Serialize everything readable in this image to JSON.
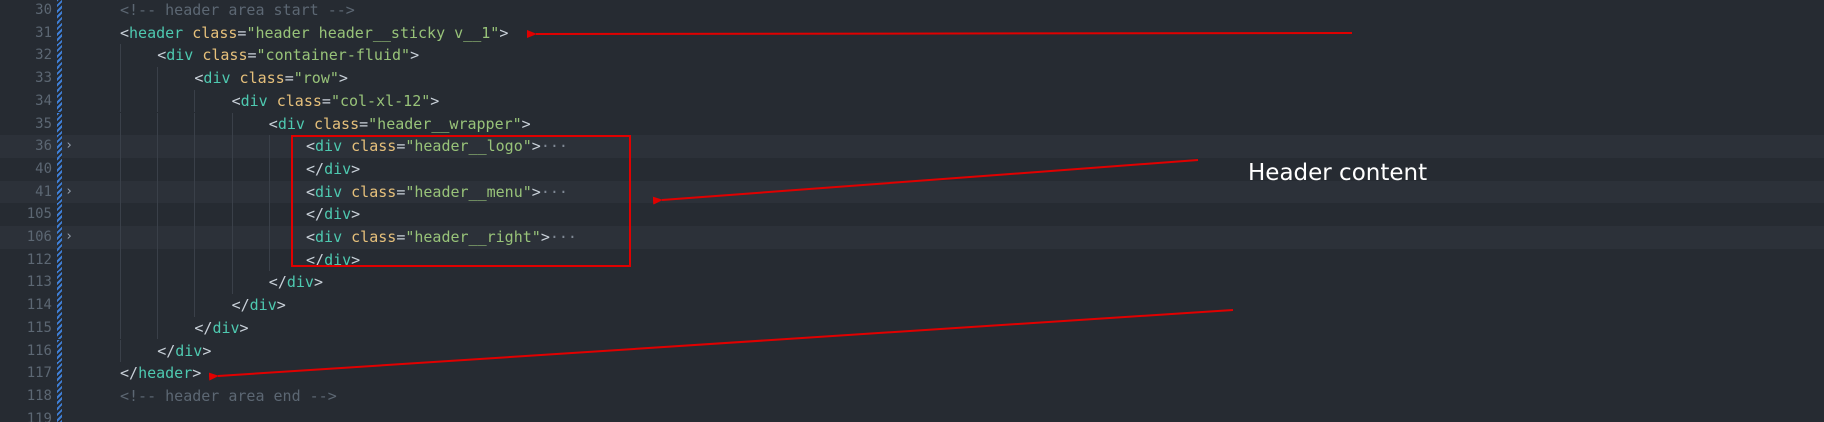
{
  "editor": {
    "lines": [
      {
        "num": "30",
        "indent": 1,
        "tokens": [
          {
            "t": "<!-- header area start -->",
            "c": "comment"
          }
        ]
      },
      {
        "num": "31",
        "indent": 1,
        "tokens": [
          {
            "t": "<",
            "c": "punc"
          },
          {
            "t": "header",
            "c": "tag"
          },
          {
            "t": " ",
            "c": "punc"
          },
          {
            "t": "class",
            "c": "attr"
          },
          {
            "t": "=",
            "c": "eq"
          },
          {
            "t": "\"header header__sticky v__1\"",
            "c": "str"
          },
          {
            "t": ">",
            "c": "punc"
          }
        ]
      },
      {
        "num": "32",
        "indent": 2,
        "tokens": [
          {
            "t": "<",
            "c": "punc"
          },
          {
            "t": "div",
            "c": "tag"
          },
          {
            "t": " ",
            "c": "punc"
          },
          {
            "t": "class",
            "c": "attr"
          },
          {
            "t": "=",
            "c": "eq"
          },
          {
            "t": "\"container-fluid\"",
            "c": "str"
          },
          {
            "t": ">",
            "c": "punc"
          }
        ]
      },
      {
        "num": "33",
        "indent": 3,
        "tokens": [
          {
            "t": "<",
            "c": "punc"
          },
          {
            "t": "div",
            "c": "tag"
          },
          {
            "t": " ",
            "c": "punc"
          },
          {
            "t": "class",
            "c": "attr"
          },
          {
            "t": "=",
            "c": "eq"
          },
          {
            "t": "\"row\"",
            "c": "str"
          },
          {
            "t": ">",
            "c": "punc"
          }
        ]
      },
      {
        "num": "34",
        "indent": 4,
        "tokens": [
          {
            "t": "<",
            "c": "punc"
          },
          {
            "t": "div",
            "c": "tag"
          },
          {
            "t": " ",
            "c": "punc"
          },
          {
            "t": "class",
            "c": "attr"
          },
          {
            "t": "=",
            "c": "eq"
          },
          {
            "t": "\"col-xl-12\"",
            "c": "str"
          },
          {
            "t": ">",
            "c": "punc"
          }
        ]
      },
      {
        "num": "35",
        "indent": 5,
        "tokens": [
          {
            "t": "<",
            "c": "punc"
          },
          {
            "t": "div",
            "c": "tag"
          },
          {
            "t": " ",
            "c": "punc"
          },
          {
            "t": "class",
            "c": "attr"
          },
          {
            "t": "=",
            "c": "eq"
          },
          {
            "t": "\"header__wrapper\"",
            "c": "str"
          },
          {
            "t": ">",
            "c": "punc"
          }
        ]
      },
      {
        "num": "36",
        "indent": 6,
        "folded": true,
        "tokens": [
          {
            "t": "<",
            "c": "punc"
          },
          {
            "t": "div",
            "c": "tag"
          },
          {
            "t": " ",
            "c": "punc"
          },
          {
            "t": "class",
            "c": "attr"
          },
          {
            "t": "=",
            "c": "eq"
          },
          {
            "t": "\"header__logo\"",
            "c": "str"
          },
          {
            "t": ">",
            "c": "punc"
          },
          {
            "t": "···",
            "c": "dots"
          }
        ]
      },
      {
        "num": "40",
        "indent": 6,
        "tokens": [
          {
            "t": "</",
            "c": "punc"
          },
          {
            "t": "div",
            "c": "tag"
          },
          {
            "t": ">",
            "c": "punc"
          }
        ]
      },
      {
        "num": "41",
        "indent": 6,
        "folded": true,
        "tokens": [
          {
            "t": "<",
            "c": "punc"
          },
          {
            "t": "div",
            "c": "tag"
          },
          {
            "t": " ",
            "c": "punc"
          },
          {
            "t": "class",
            "c": "attr"
          },
          {
            "t": "=",
            "c": "eq"
          },
          {
            "t": "\"header__menu\"",
            "c": "str"
          },
          {
            "t": ">",
            "c": "punc"
          },
          {
            "t": "···",
            "c": "dots"
          }
        ]
      },
      {
        "num": "105",
        "indent": 6,
        "tokens": [
          {
            "t": "</",
            "c": "punc"
          },
          {
            "t": "div",
            "c": "tag"
          },
          {
            "t": ">",
            "c": "punc"
          }
        ]
      },
      {
        "num": "106",
        "indent": 6,
        "folded": true,
        "tokens": [
          {
            "t": "<",
            "c": "punc"
          },
          {
            "t": "div",
            "c": "tag"
          },
          {
            "t": " ",
            "c": "punc"
          },
          {
            "t": "class",
            "c": "attr"
          },
          {
            "t": "=",
            "c": "eq"
          },
          {
            "t": "\"header__right\"",
            "c": "str"
          },
          {
            "t": ">",
            "c": "punc"
          },
          {
            "t": "···",
            "c": "dots"
          }
        ]
      },
      {
        "num": "112",
        "indent": 6,
        "tokens": [
          {
            "t": "</",
            "c": "punc"
          },
          {
            "t": "div",
            "c": "tag"
          },
          {
            "t": ">",
            "c": "punc"
          }
        ]
      },
      {
        "num": "113",
        "indent": 5,
        "tokens": [
          {
            "t": "</",
            "c": "punc"
          },
          {
            "t": "div",
            "c": "tag"
          },
          {
            "t": ">",
            "c": "punc"
          }
        ]
      },
      {
        "num": "114",
        "indent": 4,
        "tokens": [
          {
            "t": "</",
            "c": "punc"
          },
          {
            "t": "div",
            "c": "tag"
          },
          {
            "t": ">",
            "c": "punc"
          }
        ]
      },
      {
        "num": "115",
        "indent": 3,
        "tokens": [
          {
            "t": "</",
            "c": "punc"
          },
          {
            "t": "div",
            "c": "tag"
          },
          {
            "t": ">",
            "c": "punc"
          }
        ]
      },
      {
        "num": "116",
        "indent": 2,
        "tokens": [
          {
            "t": "</",
            "c": "punc"
          },
          {
            "t": "div",
            "c": "tag"
          },
          {
            "t": ">",
            "c": "punc"
          }
        ]
      },
      {
        "num": "117",
        "indent": 1,
        "tokens": [
          {
            "t": "</",
            "c": "punc"
          },
          {
            "t": "header",
            "c": "tag"
          },
          {
            "t": ">",
            "c": "punc"
          }
        ]
      },
      {
        "num": "118",
        "indent": 1,
        "tokens": [
          {
            "t": "<!-- header area end -->",
            "c": "comment"
          }
        ]
      },
      {
        "num": "119",
        "indent": 1,
        "tokens": []
      }
    ],
    "fold_chevron": "›"
  },
  "annotation": {
    "label": "Header content",
    "color": "#e00000"
  },
  "colors": {
    "background": "#262b32",
    "tag": "#4ec9b0",
    "attribute": "#e6c07b",
    "string": "#98c379",
    "comment": "#5c6773",
    "line_number": "#5c6773",
    "modified_bar": "#3f7fd6"
  }
}
